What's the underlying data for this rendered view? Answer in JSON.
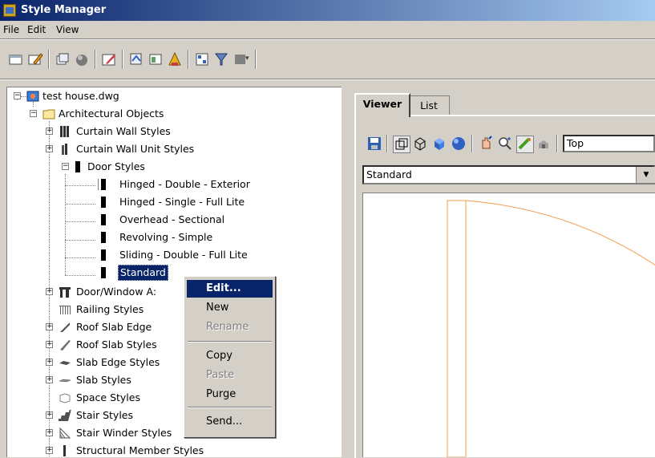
{
  "window": {
    "title": "Style Manager"
  },
  "menu": [
    {
      "label": "File"
    },
    {
      "label": "Edit"
    },
    {
      "label": "View"
    }
  ],
  "toolbar": {
    "icons": [
      "new-icon",
      "open-drawing-icon",
      "copy-icon",
      "purge-icon",
      "edit-style-icon",
      "set-from-icon",
      "toggle-view-icon",
      "sort-icon",
      "filter-style-icon",
      "show-display-icon",
      "dropdown-icon"
    ]
  },
  "tree": {
    "root": "test house.dwg",
    "group": "Architectural Objects",
    "items": [
      {
        "label": "Curtain Wall Styles"
      },
      {
        "label": "Curtain Wall Unit Styles"
      },
      {
        "label": "Door Styles"
      },
      {
        "label": "Hinged - Double - Exterior"
      },
      {
        "label": "Hinged - Single - Full Lite"
      },
      {
        "label": "Overhead - Sectional"
      },
      {
        "label": "Revolving - Simple"
      },
      {
        "label": "Sliding - Double - Full Lite"
      },
      {
        "label": "Standard"
      },
      {
        "label": "Door/Window A:"
      },
      {
        "label": "Railing Styles"
      },
      {
        "label": "Roof Slab Edge"
      },
      {
        "label": "Roof Slab Styles"
      },
      {
        "label": "Slab Edge Styles"
      },
      {
        "label": "Slab Styles"
      },
      {
        "label": "Space Styles"
      },
      {
        "label": "Stair Styles"
      },
      {
        "label": "Stair Winder Styles"
      },
      {
        "label": "Structural Member Styles"
      }
    ]
  },
  "context_menu": {
    "items": [
      {
        "label": "Edit...",
        "highlighted": true
      },
      {
        "label": "New"
      },
      {
        "label": "Rename",
        "disabled": true
      },
      {
        "label": "Copy"
      },
      {
        "label": "Paste",
        "disabled": true
      },
      {
        "label": "Purge"
      },
      {
        "label": "Send..."
      }
    ]
  },
  "tabs": [
    {
      "label": "Viewer",
      "active": true
    },
    {
      "label": "List"
    }
  ],
  "viewer": {
    "view_combo": "Top",
    "display_combo": "Standard"
  },
  "colors": {
    "selection": "#0a246a",
    "door_arc": "#f0a050"
  }
}
